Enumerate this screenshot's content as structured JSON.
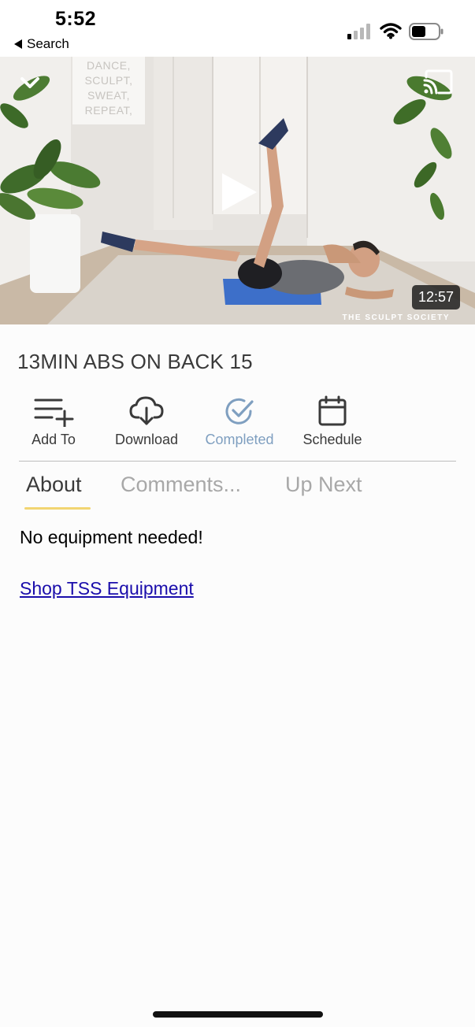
{
  "status_bar": {
    "time": "5:52",
    "back_label": "Search"
  },
  "video": {
    "duration": "12:57",
    "watermark": "THE SCULPT SOCIETY",
    "wall_sign": [
      "DANCE,",
      "SCULPT,",
      "SWEAT,",
      "REPEAT,"
    ],
    "icons": {
      "collapse": "chevron-down-icon",
      "cast": "cast-icon",
      "play": "play-icon"
    }
  },
  "title": "13MIN ABS ON BACK 15",
  "actions": [
    {
      "label": "Add To",
      "icon": "playlist-add-icon"
    },
    {
      "label": "Download",
      "icon": "cloud-download-icon"
    },
    {
      "label": "Completed",
      "icon": "check-circle-icon"
    },
    {
      "label": "Schedule",
      "icon": "calendar-icon"
    }
  ],
  "tabs": [
    {
      "label": "About",
      "active": true
    },
    {
      "label": "Comments...",
      "active": false
    },
    {
      "label": "Up Next",
      "active": false
    }
  ],
  "about": {
    "text": "No equipment needed!",
    "link_text": "Shop TSS Equipment"
  },
  "colors": {
    "tab_underline": "#f2d572",
    "completed": "#7f9fc0",
    "link": "#1a0dab"
  }
}
